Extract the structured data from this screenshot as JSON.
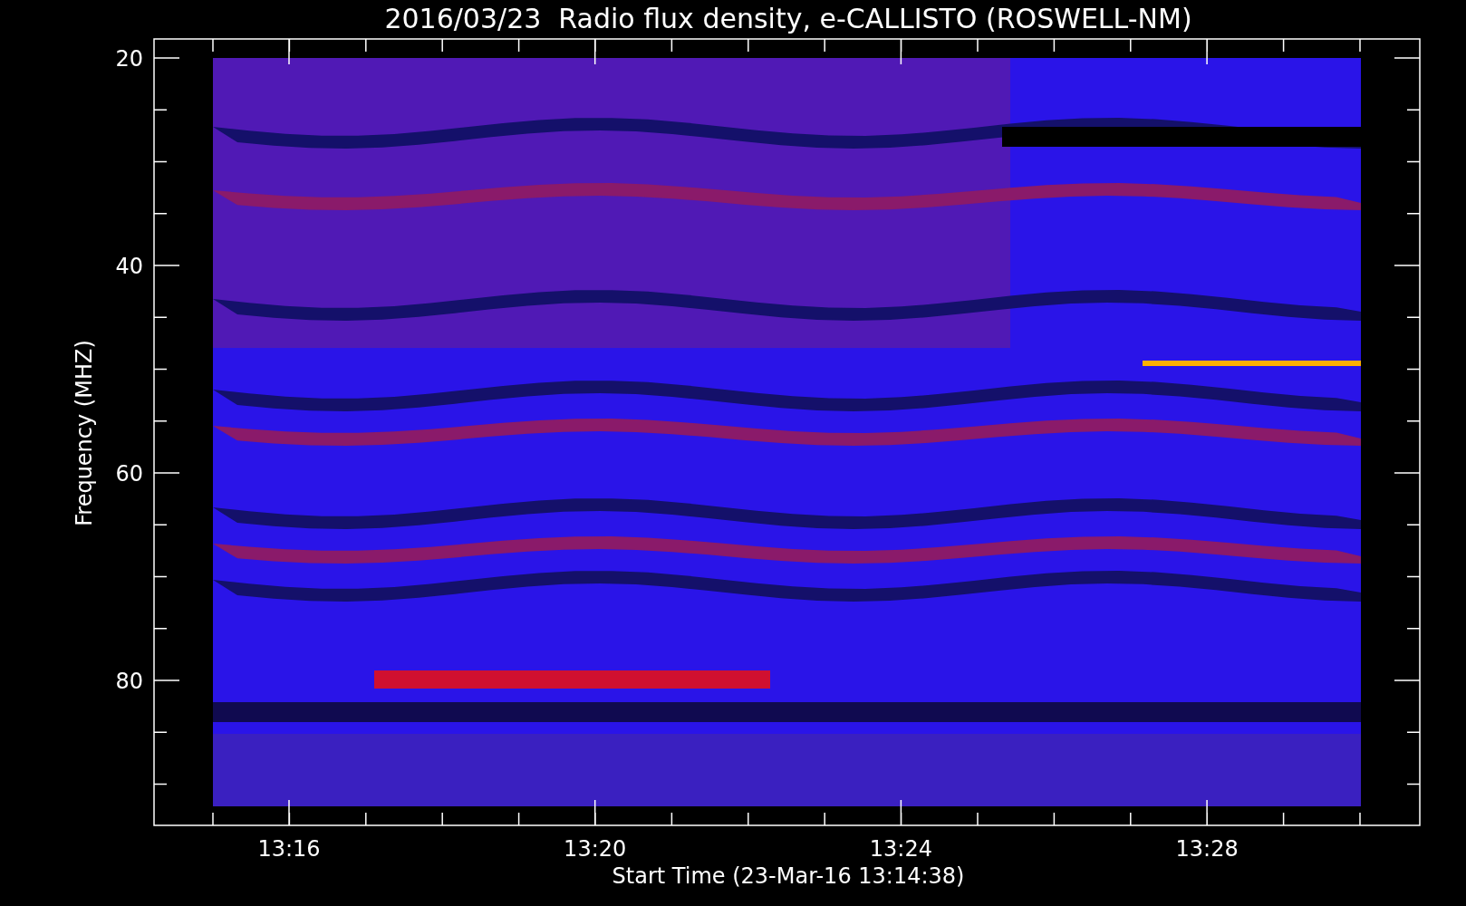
{
  "plot": {
    "title": "2016/03/23  Radio flux density, e-CALLISTO (ROSWELL-NM)",
    "ylabel": "Frequency (MHZ)",
    "xlabel": "Start Time (23-Mar-16 13:14:38)",
    "y_tick_labels": [
      "20",
      "40",
      "60",
      "80"
    ],
    "x_tick_labels": [
      "13:16",
      "13:20",
      "13:24",
      "13:28"
    ]
  }
}
